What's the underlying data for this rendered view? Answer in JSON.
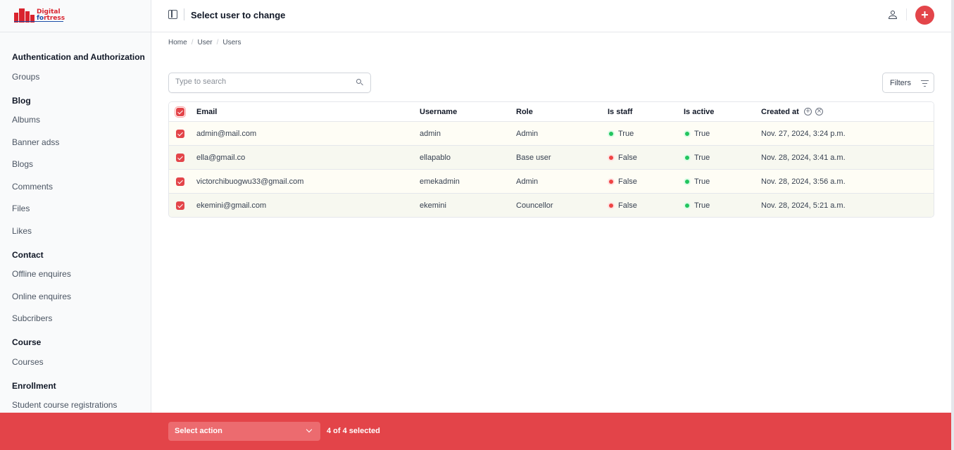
{
  "brand": {
    "logo_line1": "Digital",
    "logo_line2a": "f",
    "logo_line2b": "o",
    "logo_line2c": "rtress",
    "accent_color": "#e3454a"
  },
  "header": {
    "title": "Select user to change"
  },
  "breadcrumb": [
    "Home",
    "User",
    "Users"
  ],
  "sidebar": {
    "groups": [
      {
        "title": "Authentication and Authorization",
        "items": [
          "Groups"
        ]
      },
      {
        "title": "Blog",
        "items": [
          "Albums",
          "Banner adss",
          "Blogs",
          "Comments",
          "Files",
          "Likes"
        ]
      },
      {
        "title": "Contact",
        "items": [
          "Offline enquires",
          "Online enquires",
          "Subcribers"
        ]
      },
      {
        "title": "Course",
        "items": [
          "Courses"
        ]
      },
      {
        "title": "Enrollment",
        "items": [
          "Student course registrations"
        ]
      }
    ]
  },
  "search": {
    "placeholder": "Type to search",
    "value": ""
  },
  "filters": {
    "label": "Filters"
  },
  "table": {
    "columns": [
      "Email",
      "Username",
      "Role",
      "Is staff",
      "Is active",
      "Created at"
    ],
    "rows": [
      {
        "email": "admin@mail.com",
        "username": "admin",
        "role": "Admin",
        "is_staff": "True",
        "is_active": "True",
        "created_at": "Nov. 27, 2024, 3:24 p.m."
      },
      {
        "email": "ella@gmail.co",
        "username": "ellapablo",
        "role": "Base user",
        "is_staff": "False",
        "is_active": "True",
        "created_at": "Nov. 28, 2024, 3:41 a.m."
      },
      {
        "email": "victorchibuogwu33@gmail.com",
        "username": "emekadmin",
        "role": "Admin",
        "is_staff": "False",
        "is_active": "True",
        "created_at": "Nov. 28, 2024, 3:56 a.m."
      },
      {
        "email": "ekemini@gmail.com",
        "username": "ekemini",
        "role": "Councellor",
        "is_staff": "False",
        "is_active": "True",
        "created_at": "Nov. 28, 2024, 5:21 a.m."
      }
    ]
  },
  "actions": {
    "select_label": "Select action",
    "selected_count": "4 of 4 selected"
  },
  "icons": {
    "sidebar_toggle": "sidebar-toggle-icon",
    "user": "user-icon",
    "add": "plus-icon",
    "search": "search-icon",
    "filter": "filter-icon",
    "sort_add": "plus-circle-icon",
    "sort_clear": "x-circle-icon",
    "chevron": "chevron-down-icon"
  },
  "status_colors": {
    "true": "#22c55e",
    "false": "#ef4444"
  }
}
